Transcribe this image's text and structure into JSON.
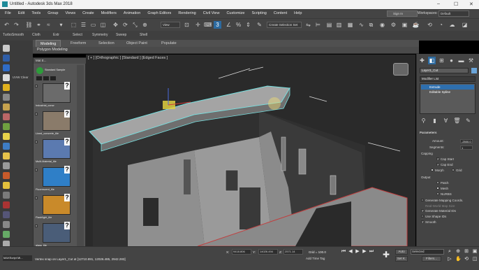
{
  "window": {
    "title": "Untitled - Autodesk 3ds Max 2018",
    "min": "–",
    "max": "☐",
    "close": "✕"
  },
  "menu": {
    "items": [
      "File",
      "Edit",
      "Tools",
      "Group",
      "Views",
      "Create",
      "Modifiers",
      "Animation",
      "Graph Editors",
      "Rendering",
      "Civil View",
      "Customize",
      "Scripting",
      "Content",
      "Help"
    ],
    "signin": "Sign In",
    "workspaces_label": "Workspaces:",
    "workspace_value": "Default"
  },
  "toolbar": {
    "view_dropdown": "View",
    "selection_set": "Create Selection Set",
    "angle_snap_value": "3"
  },
  "toolbar2": {
    "items": [
      "TurboSmooth",
      "Cloth",
      "Extr",
      "Select",
      "Symmetry",
      "Sweep",
      "Shell"
    ]
  },
  "ribbon": {
    "tabs": [
      "Modeling",
      "Freeform",
      "Selection",
      "Object Paint",
      "Populate"
    ],
    "active_tab": "Modeling",
    "subtitle": "Polygon Modeling"
  },
  "left_panel": {
    "uvw_label": "UVW Clear"
  },
  "material_panel": {
    "title": "Mat E...",
    "tab_label": "Standard Sample",
    "swatches": [
      {
        "label": "Industrial_concr",
        "color": "#6b6b6b"
      },
      {
        "label": "Lined_concrete_tile",
        "color": "#8a7b6a"
      },
      {
        "label": "Multi-Material_tile",
        "color": "#5b7ab0"
      },
      {
        "label": "Fluorescent_tile",
        "color": "#2f7fc7"
      },
      {
        "label": "Flashlight_tile",
        "color": "#c98a2a"
      },
      {
        "label": "glass_tile",
        "color": "#4a5d78"
      }
    ]
  },
  "viewport": {
    "label": "[ + ] [Orthographic ] [Standard ] [Edged Faces ]"
  },
  "command_panel": {
    "object_name": "Layer1_Cut",
    "modifier_list": "Modifier List",
    "stack": [
      "Extrude",
      "Editable Spline"
    ],
    "parameters_title": "Parameters",
    "amount_label": "Amount:",
    "amount_value": "-2500.0",
    "segments_label": "Segments:",
    "segments_value": "1",
    "capping_label": "Capping",
    "cap_start": "Cap Start",
    "cap_end": "Cap End",
    "morph": "Morph",
    "grid": "Grid",
    "output_label": "Output",
    "patch": "Patch",
    "mesh": "Mesh",
    "nurbs": "NURBS",
    "gen_mapping": "Generate Mapping Coords.",
    "real_world": "Real-World Map Size",
    "gen_mat_ids": "Generate Material IDs",
    "use_shape_ids": "Use Shape IDs",
    "smooth": "Smooth"
  },
  "status": {
    "maxscript": "MAXScript Mi...",
    "message": "Vertex snap on Layer1_Cut at [12710.891, 12026.485, 2942.283]",
    "x_label": "X:",
    "x_value": "9418.806",
    "y_label": "Y:",
    "y_value": "14026.494",
    "z_label": "Z:",
    "z_value": "2571.14",
    "grid_label": "Grid = 100.0",
    "add_time_tag": "Add Time Tag",
    "auto": "Auto",
    "setk": "Set K.",
    "selected": "Selected",
    "filters": "Filters..."
  }
}
